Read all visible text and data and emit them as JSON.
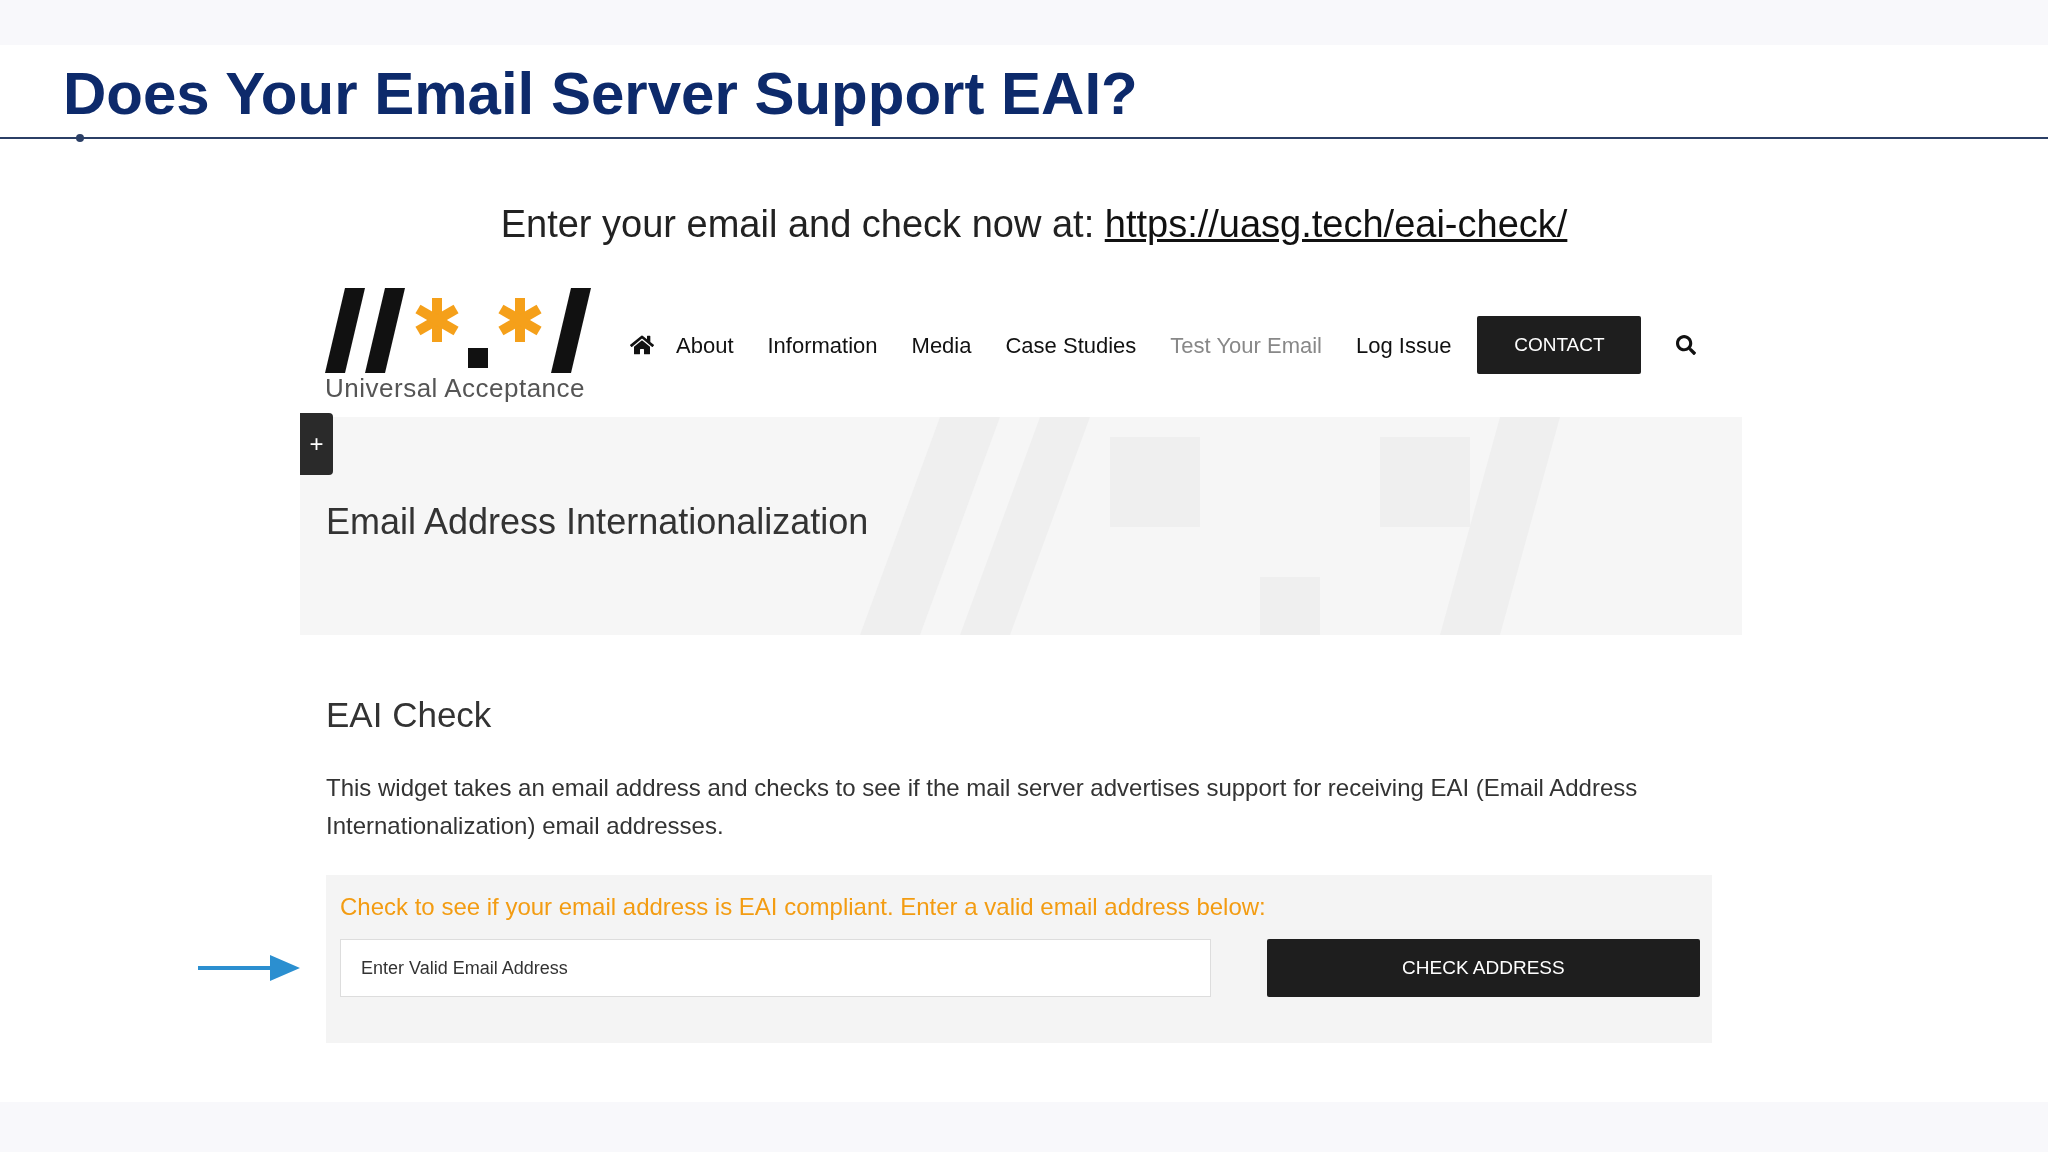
{
  "slide": {
    "title": "Does Your Email Server Support EAI?",
    "intro": "Enter your email and check now at:",
    "link": "https://uasg.tech/eai-check/"
  },
  "site": {
    "logo_caption": "Universal Acceptance",
    "nav": [
      {
        "label": "About",
        "selected": false
      },
      {
        "label": "Information",
        "selected": false
      },
      {
        "label": "Media",
        "selected": false
      },
      {
        "label": "Case Studies",
        "selected": false
      },
      {
        "label": "Test Your Email",
        "selected": true
      },
      {
        "label": "Log Issue",
        "selected": false
      }
    ],
    "contact_button": "CONTACT",
    "side_tab": "+",
    "page_title": "Email Address Internationalization",
    "section_title": "EAI Check",
    "description": "This widget takes an email address and checks to see if the mail server advertises support for receiving EAI (Email Address Internationalization) email addresses.",
    "form": {
      "prompt": "Check to see if your email address is EAI compliant. Enter a valid email address below:",
      "placeholder": "Enter Valid Email Address",
      "button": "CHECK ADDRESS"
    }
  }
}
